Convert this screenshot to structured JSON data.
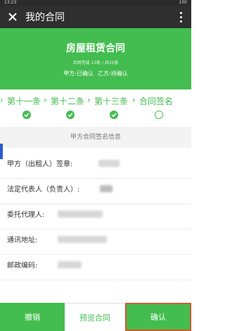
{
  "status_bar": {
    "time": "13:23",
    "right": "100"
  },
  "titlebar": {
    "title": "我的合同"
  },
  "hero": {
    "title": "房屋租赁合同",
    "subtitle": "合同完成 13条 / 共15条",
    "party_a": "甲方:已确认",
    "party_b": "乙方:待确认"
  },
  "steps": [
    {
      "label": "第十一条",
      "state": "done"
    },
    {
      "label": "第十二条",
      "state": "done"
    },
    {
      "label": "第十三条",
      "state": "done"
    },
    {
      "label": "合同签名",
      "state": "current"
    }
  ],
  "section": {
    "heading": "甲方合同签名信息"
  },
  "form": {
    "rows": [
      {
        "label": "甲方（出租人）签章:"
      },
      {
        "label": "法定代表人（负责人）:"
      },
      {
        "label": "委托代理人:"
      },
      {
        "label": "通讯地址:"
      },
      {
        "label": "邮政编码:"
      }
    ]
  },
  "actions": {
    "cancel": "撤销",
    "preview": "预览合同",
    "confirm": "确认"
  },
  "colors": {
    "primary": "#43bd4f",
    "titlebar": "#2f2f2f",
    "highlight": "#d8572a"
  }
}
